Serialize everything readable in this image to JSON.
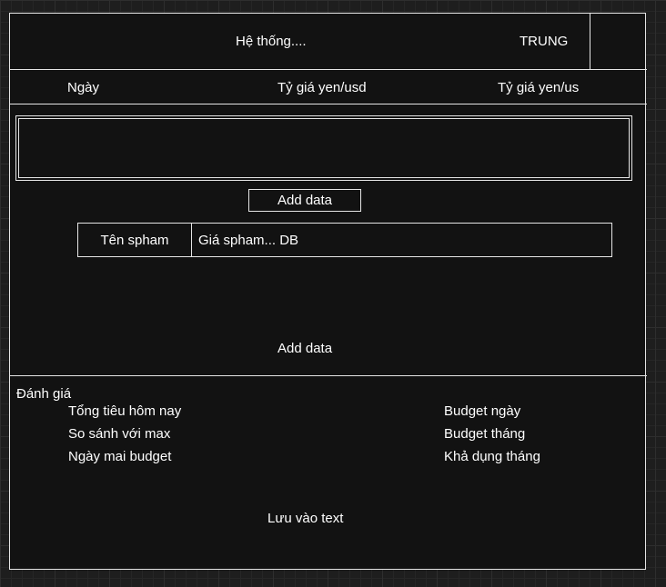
{
  "header": {
    "title": "Hệ thống....",
    "user": "TRUNG"
  },
  "columns": {
    "date": "Ngày",
    "rate_yen_usd": "Tỷ giá yen/usd",
    "rate_yen_us": "Tỷ giá yen/us"
  },
  "entry": {
    "add_data_button": "Add data",
    "product_name": "Tên spham",
    "product_price": "Giá spham... DB",
    "add_data_label": "Add data"
  },
  "evaluation": {
    "title": "Đánh giá",
    "left_items": [
      "Tổng tiêu hôm nay",
      "So sánh với max",
      "Ngày mai budget"
    ],
    "right_items": [
      "Budget ngày",
      "Budget tháng",
      "Khả dụng tháng"
    ],
    "save_label": "Lưu vào text"
  }
}
